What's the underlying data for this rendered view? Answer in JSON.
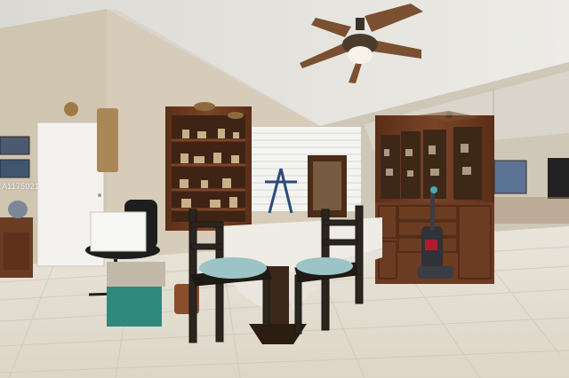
{
  "watermark": "A1175021",
  "scene": {
    "ceiling_color": "#e4e2dc",
    "wall_color": "#d3c9b7",
    "floor_color": "#e6e0d4",
    "wood_color": "#6a3a22",
    "tablecloth_color": "#ece8e2",
    "chair_cushion_color": "#9cc4c6"
  }
}
